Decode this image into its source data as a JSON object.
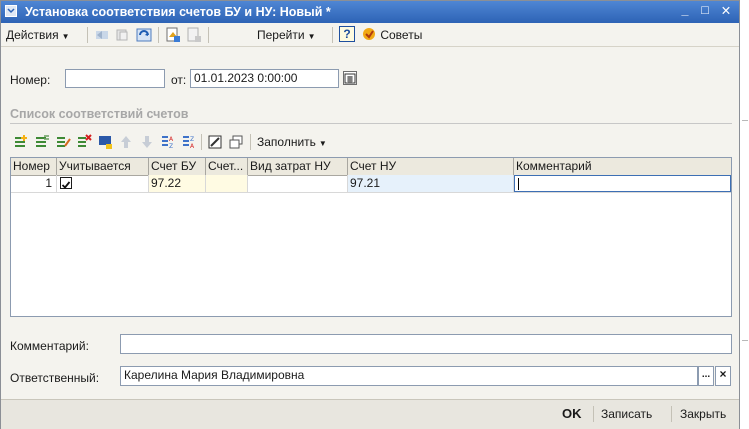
{
  "window": {
    "title": "Установка соответствия счетов БУ и НУ: Новый *",
    "minimize": "_",
    "maximize": "□",
    "close": "✕"
  },
  "toolbar": {
    "actions_label": "Действия",
    "goto_label": "Перейти",
    "help_label": "?",
    "tips_label": "Советы"
  },
  "header": {
    "number_label": "Номер:",
    "number_value": "",
    "date_label": "от:",
    "date_value": "01.01.2023  0:00:00"
  },
  "section": {
    "title": "Список соответствий счетов"
  },
  "table_toolbar": {
    "fill_label": "Заполнить"
  },
  "table": {
    "columns": [
      "Номер",
      "Учитывается",
      "Счет БУ",
      "Счет...",
      "Вид затрат НУ",
      "Счет НУ",
      "Комментарий"
    ],
    "rows": [
      {
        "number": "1",
        "considered": true,
        "account_bu": "97.22",
        "account_extra": "",
        "cost_type_nu": "",
        "account_nu": "97.21",
        "comment": ""
      }
    ]
  },
  "comment": {
    "label": "Комментарий:",
    "value": ""
  },
  "responsible": {
    "label": "Ответственный:",
    "value": "Карелина Мария Владимировна",
    "select_btn": "...",
    "clear_btn": "×"
  },
  "footer": {
    "ok_label": "OK",
    "save_label": "Записать",
    "close_label": "Закрыть"
  },
  "colors": {
    "titlebar": "#2d63b5",
    "window_bg": "#f4f3ee",
    "selected_cell": "#e6f1fb",
    "yellow_cell": "#fffbe3"
  }
}
